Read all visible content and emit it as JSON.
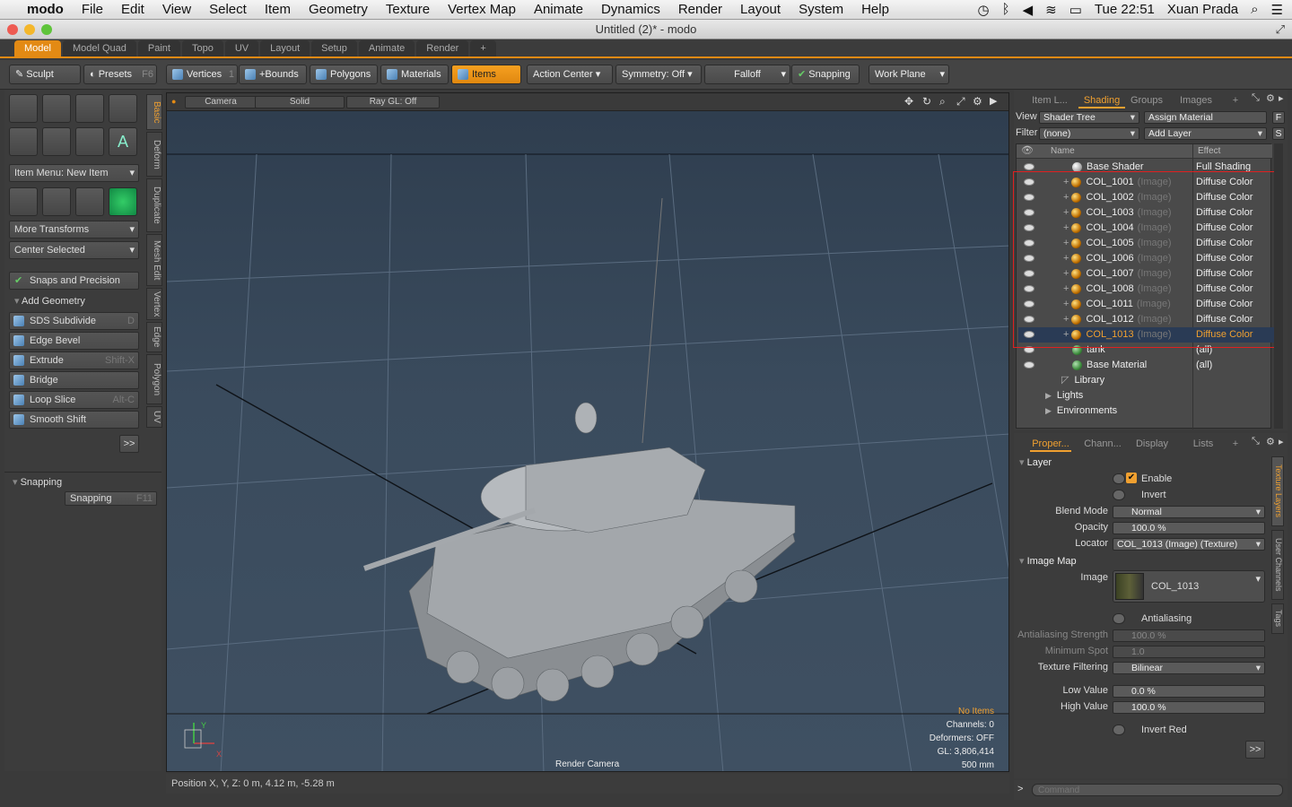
{
  "menubar": {
    "apple_icon": "apple-icon",
    "app": "modo",
    "items": [
      "File",
      "Edit",
      "View",
      "Select",
      "Item",
      "Geometry",
      "Texture",
      "Vertex Map",
      "Animate",
      "Dynamics",
      "Render",
      "Layout",
      "System",
      "Help"
    ],
    "clock": "Tue 22:51",
    "user": "Xuan Prada"
  },
  "window": {
    "title": "Untitled (2)* - modo"
  },
  "tabs": [
    "Model",
    "Model Quad",
    "Paint",
    "Topo",
    "UV",
    "Layout",
    "Setup",
    "Animate",
    "Render",
    "+"
  ],
  "toolbar": {
    "sculpt": "Sculpt",
    "presets": "Presets",
    "presets_key": "F6",
    "vertices": "Vertices",
    "vertices_count": "1",
    "bounds": "+Bounds",
    "polygons": "Polygons",
    "materials": "Materials",
    "items": "Items",
    "action_center": "Action Center",
    "symmetry": "Symmetry: Off",
    "falloff": "Falloff",
    "snapping": "Snapping",
    "work_plane": "Work Plane"
  },
  "left": {
    "item_menu": "Item Menu: New Item",
    "more_transforms": "More Transforms",
    "center_selected": "Center Selected",
    "snaps": "Snaps and Precision",
    "add_geometry": "Add Geometry",
    "tools": [
      {
        "label": "SDS Subdivide",
        "key": "D"
      },
      {
        "label": "Edge Bevel",
        "key": ""
      },
      {
        "label": "Extrude",
        "key": "Shift-X"
      },
      {
        "label": "Bridge",
        "key": ""
      },
      {
        "label": "Loop Slice",
        "key": "Alt-C"
      },
      {
        "label": "Smooth Shift",
        "key": ""
      }
    ],
    "more": ">>",
    "snapping_header": "Snapping",
    "snapping_btn": "Snapping",
    "snapping_key": "F11",
    "vtabs": [
      "Basic",
      "Deform",
      "Duplicate",
      "Mesh Edit",
      "Vertex",
      "Edge",
      "Polygon",
      "UV"
    ]
  },
  "viewport": {
    "camera": "Camera",
    "shading": "Solid",
    "raygl": "Ray GL: Off",
    "stats": {
      "noitems": "No Items",
      "channels": "Channels: 0",
      "deformers": "Deformers: OFF",
      "gl": "GL: 3,806,414",
      "scale": "500 mm"
    },
    "render_camera": "Render Camera",
    "axis_y": "Y",
    "axis_x": "X"
  },
  "status": {
    "position": "Position X, Y, Z:   0 m, 4.12 m, -5.28 m"
  },
  "shader": {
    "tabs": [
      "Item L...",
      "Shading",
      "Groups",
      "Images",
      "+"
    ],
    "view_label": "View",
    "view_value": "Shader Tree",
    "assign": "Assign Material",
    "assign_key": "F",
    "filter_label": "Filter",
    "filter_value": "(none)",
    "add_layer": "Add Layer",
    "add_layer_key": "S",
    "col_name": "Name",
    "col_effect": "Effect",
    "rows": [
      {
        "name": "Base Shader",
        "tag": "",
        "effect": "Full Shading",
        "type": "w",
        "sel": false
      },
      {
        "name": "COL_1001",
        "tag": "(Image)",
        "effect": "Diffuse Color",
        "type": "o",
        "sel": false
      },
      {
        "name": "COL_1002",
        "tag": "(Image)",
        "effect": "Diffuse Color",
        "type": "o",
        "sel": false
      },
      {
        "name": "COL_1003",
        "tag": "(Image)",
        "effect": "Diffuse Color",
        "type": "o",
        "sel": false
      },
      {
        "name": "COL_1004",
        "tag": "(Image)",
        "effect": "Diffuse Color",
        "type": "o",
        "sel": false
      },
      {
        "name": "COL_1005",
        "tag": "(Image)",
        "effect": "Diffuse Color",
        "type": "o",
        "sel": false
      },
      {
        "name": "COL_1006",
        "tag": "(Image)",
        "effect": "Diffuse Color",
        "type": "o",
        "sel": false
      },
      {
        "name": "COL_1007",
        "tag": "(Image)",
        "effect": "Diffuse Color",
        "type": "o",
        "sel": false
      },
      {
        "name": "COL_1008",
        "tag": "(Image)",
        "effect": "Diffuse Color",
        "type": "o",
        "sel": false
      },
      {
        "name": "COL_1011",
        "tag": "(Image)",
        "effect": "Diffuse Color",
        "type": "o",
        "sel": false
      },
      {
        "name": "COL_1012",
        "tag": "(Image)",
        "effect": "Diffuse Color",
        "type": "o",
        "sel": false
      },
      {
        "name": "COL_1013",
        "tag": "(Image)",
        "effect": "Diffuse Color",
        "type": "o",
        "sel": true
      },
      {
        "name": "tank",
        "tag": "",
        "effect": "(all)",
        "type": "g",
        "sel": false
      },
      {
        "name": "Base Material",
        "tag": "",
        "effect": "(all)",
        "type": "g",
        "sel": false
      },
      {
        "name": "Library",
        "tag": "",
        "effect": "",
        "type": "f",
        "sel": false
      },
      {
        "name": "Lights",
        "tag": "",
        "effect": "",
        "type": "t",
        "sel": false
      },
      {
        "name": "Environments",
        "tag": "",
        "effect": "",
        "type": "t",
        "sel": false
      }
    ]
  },
  "props": {
    "tabs": [
      "Proper...",
      "Chann...",
      "Display",
      "Lists",
      "+"
    ],
    "layer": "Layer",
    "enable": "Enable",
    "invert": "Invert",
    "blend_mode_label": "Blend Mode",
    "blend_mode": "Normal",
    "opacity_label": "Opacity",
    "opacity": "100.0 %",
    "locator_label": "Locator",
    "locator": "COL_1013 (Image) (Texture)",
    "image_map": "Image Map",
    "image_label": "Image",
    "image": "COL_1013",
    "antialiasing": "Antialiasing",
    "aa_strength_label": "Antialiasing Strength",
    "aa_strength": "100.0 %",
    "min_spot_label": "Minimum Spot",
    "min_spot": "1.0",
    "tex_filter_label": "Texture Filtering",
    "tex_filter": "Bilinear",
    "low_label": "Low Value",
    "low": "0.0 %",
    "high_label": "High Value",
    "high": "100.0 %",
    "invert_red": "Invert Red",
    "more": ">>",
    "side_tabs": [
      "Texture Layers",
      "User Channels",
      "Tags"
    ]
  },
  "command": {
    "prompt": ">",
    "placeholder": "Command"
  }
}
